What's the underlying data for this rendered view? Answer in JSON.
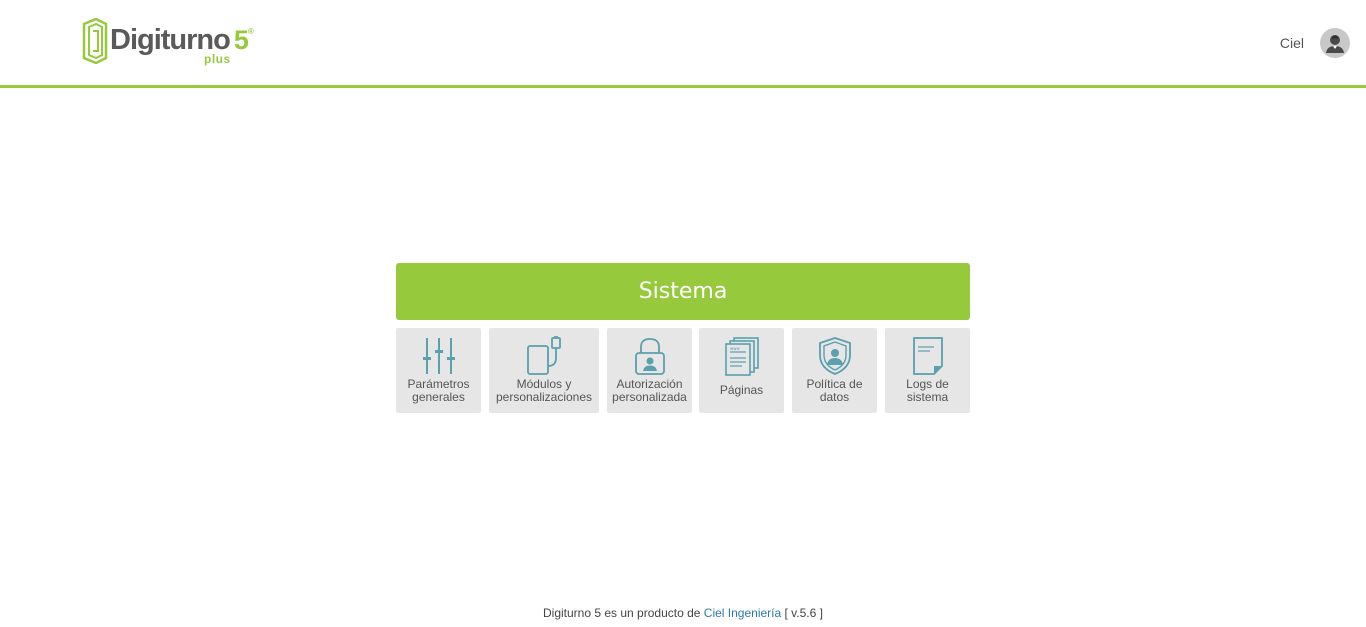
{
  "brand": {
    "word": "Digiturno",
    "five": "5",
    "reg": "®",
    "plus": "plus",
    "green": "#97c93d",
    "icon_color": "#5aa0ad"
  },
  "user": {
    "name": "Ciel"
  },
  "panel": {
    "title": "Sistema",
    "tiles": [
      {
        "line1": "Parámetros",
        "line2": "generales",
        "icon": "sliders-icon"
      },
      {
        "line1": "Módulos y",
        "line2": "personalizaciones",
        "icon": "usb-device-icon"
      },
      {
        "line1": "Autorización",
        "line2": "personalizada",
        "icon": "padlock-user-icon"
      },
      {
        "line1": "Páginas",
        "line2": "",
        "icon": "web-pages-icon"
      },
      {
        "line1": "Política de",
        "line2": "datos",
        "icon": "shield-user-icon"
      },
      {
        "line1": "Logs de",
        "line2": "sistema",
        "icon": "document-icon"
      }
    ]
  },
  "footer": {
    "prefix": "Digiturno 5 es un producto de",
    "company": "Ciel Ingeniería",
    "version": "[ v.5.6 ]"
  }
}
